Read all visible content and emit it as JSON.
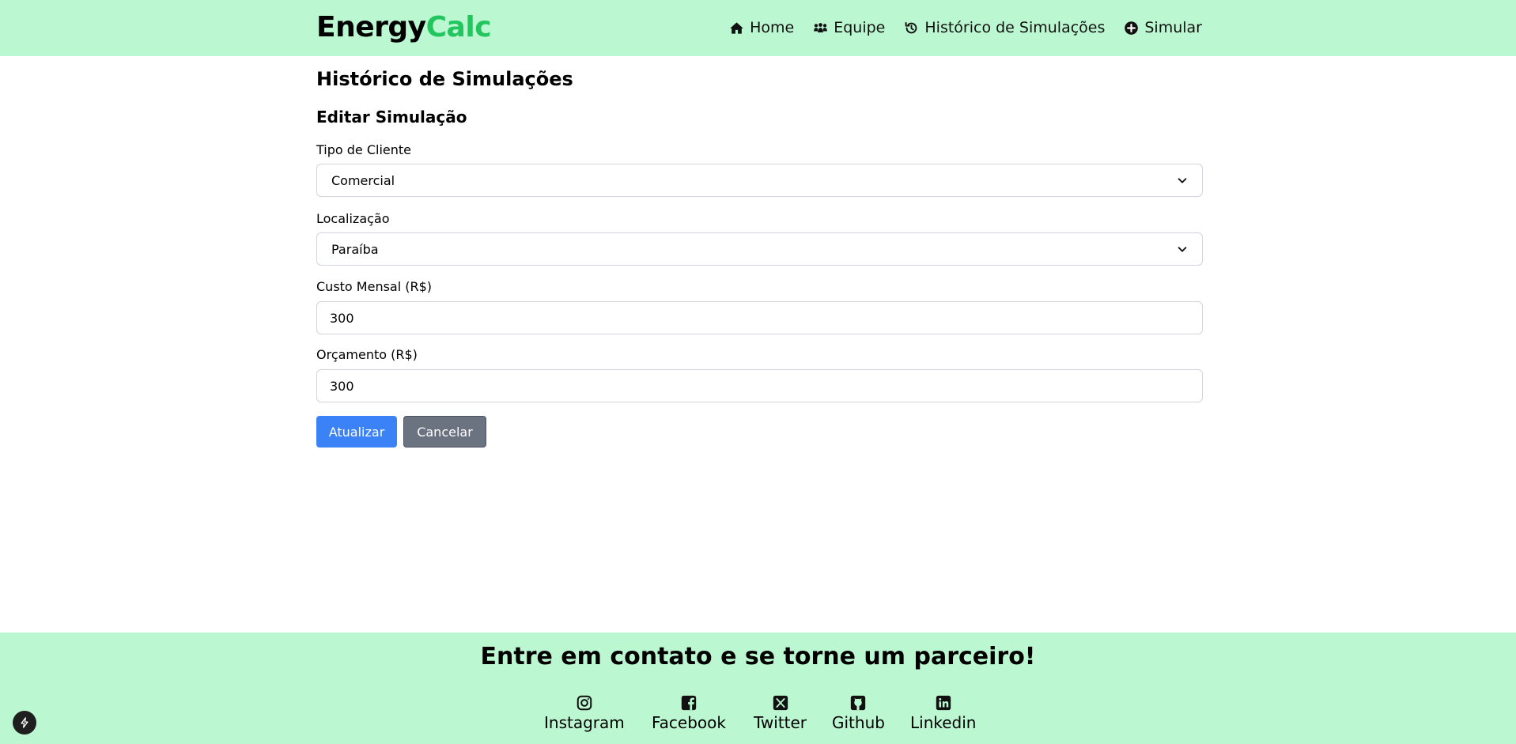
{
  "brand": {
    "part1": "Energy",
    "part2": "Calc",
    "accent_color": "#22c55e"
  },
  "nav": [
    {
      "label": "Home",
      "icon": "home-icon"
    },
    {
      "label": "Equipe",
      "icon": "users-icon"
    },
    {
      "label": "Histórico de Simulações",
      "icon": "history-icon"
    },
    {
      "label": "Simular",
      "icon": "plus-circle-icon"
    }
  ],
  "main": {
    "page_title": "Histórico de Simulações",
    "section_title": "Editar Simulação",
    "fields": {
      "client_type": {
        "label": "Tipo de Cliente",
        "value": "Comercial"
      },
      "location": {
        "label": "Localização",
        "value": "Paraíba"
      },
      "monthly_cost": {
        "label": "Custo Mensal (R$)",
        "value": "300"
      },
      "budget": {
        "label": "Orçamento (R$)",
        "value": "300"
      }
    },
    "buttons": {
      "update": "Atualizar",
      "cancel": "Cancelar"
    }
  },
  "footer": {
    "title": "Entre em contato e se torne um parceiro!",
    "links": [
      {
        "label": "Instagram",
        "icon": "instagram-icon"
      },
      {
        "label": "Facebook",
        "icon": "facebook-icon"
      },
      {
        "label": "Twitter",
        "icon": "x-twitter-icon"
      },
      {
        "label": "Github",
        "icon": "github-icon"
      },
      {
        "label": "Linkedin",
        "icon": "linkedin-icon"
      }
    ]
  },
  "colors": {
    "header_bg": "#bbf7d0",
    "primary_button": "#3b82f6",
    "secondary_button": "#6b7280"
  }
}
